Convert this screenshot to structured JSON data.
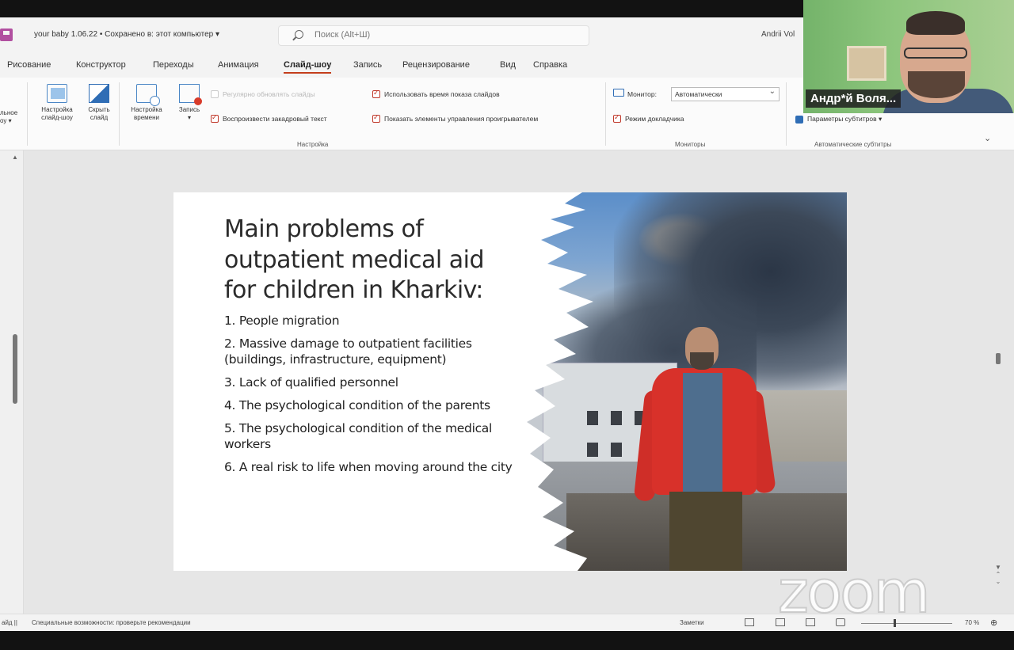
{
  "app": {
    "doc_title": "your baby 1.06.22 • Сохранено в: этот компьютер ▾",
    "search_placeholder": "Поиск (Alt+Ш)",
    "user": "Andrii Vol"
  },
  "tabs": [
    "Рисование",
    "Конструктор",
    "Переходы",
    "Анимация",
    "Слайд-шоу",
    "Запись",
    "Рецензирование",
    "Вид",
    "Справка"
  ],
  "active_tab": "Слайд-шоу",
  "ribbon": {
    "left_cut_label": "льное\nоу ▾",
    "btn_setup": "Настройка\nслайд-шоу",
    "btn_hide": "Скрыть\nслайд",
    "btn_timing": "Настройка\nвремени",
    "btn_record": "Запись\n▾",
    "chk_refresh": "Регулярно обновлять слайды",
    "chk_narration": "Воспроизвести закадровый текст",
    "chk_timings": "Использовать время показа слайдов",
    "chk_controls": "Показать элементы управления проигрывателем",
    "group_setup": "Настройка",
    "monitor_label": "Монитор:",
    "monitor_value": "Автоматически",
    "chk_presenter": "Режим докладчика",
    "group_monitors": "Мониторы",
    "subtitles_label": "Параметры субтитров ▾",
    "group_subtitles": "Автоматические субтитры"
  },
  "slide": {
    "title": "Main problems of outpatient medical aid for children in Kharkiv:",
    "items": [
      "1. People migration",
      "2. Massive damage to outpatient facilities (buildings, infrastructure, equipment)",
      "3. Lack of qualified personnel",
      "4. The psychological condition of the parents",
      "5. The psychological condition of the medical workers",
      "6. A real risk to life when moving around the city"
    ]
  },
  "status": {
    "left": "айд ||",
    "accessibility": "Специальные возможности: проверьте рекомендации",
    "notes": "Заметки",
    "zoom": "70 %"
  },
  "video": {
    "participant_name": "Андр*й Воля..."
  },
  "watermark": "zoom"
}
